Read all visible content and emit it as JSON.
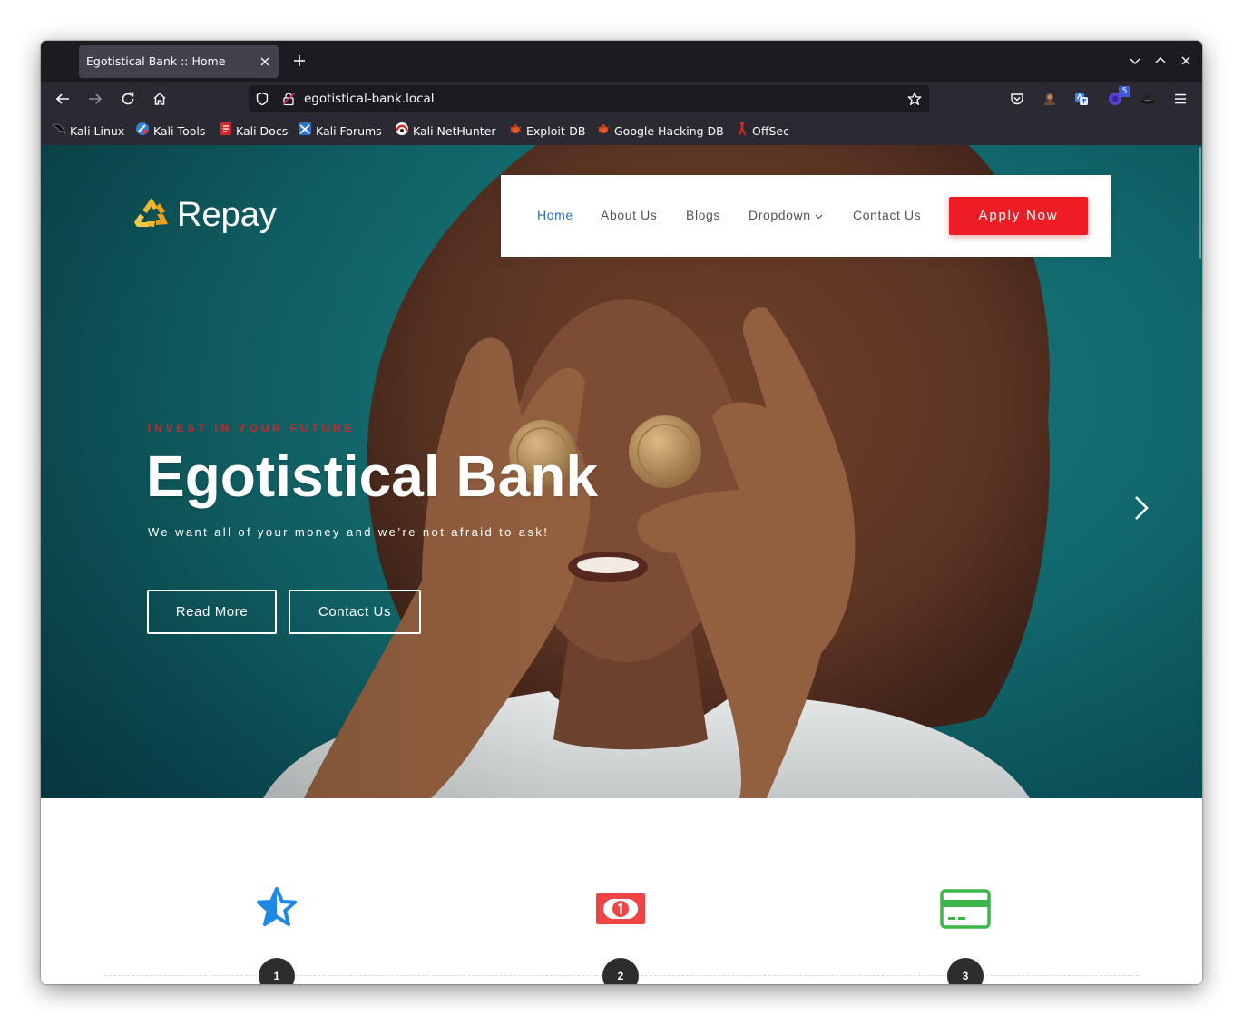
{
  "browser": {
    "tab_title": "Egotistical Bank :: Home",
    "url": "egotistical-bank.local",
    "extension_badge": "5",
    "bookmarks": [
      {
        "label": "Kali Linux",
        "icon": "kali-dragon-icon"
      },
      {
        "label": "Kali Tools",
        "icon": "kali-tools-icon"
      },
      {
        "label": "Kali Docs",
        "icon": "kali-docs-icon"
      },
      {
        "label": "Kali Forums",
        "icon": "kali-forums-icon"
      },
      {
        "label": "Kali NetHunter",
        "icon": "kali-nethunter-icon"
      },
      {
        "label": "Exploit-DB",
        "icon": "exploit-db-icon"
      },
      {
        "label": "Google Hacking DB",
        "icon": "exploit-db-icon"
      },
      {
        "label": "OffSec",
        "icon": "offsec-icon"
      }
    ]
  },
  "site": {
    "logo_text": "Repay",
    "logo_icon": "recycle-icon",
    "nav": [
      {
        "label": "Home",
        "active": true
      },
      {
        "label": "About Us",
        "active": false
      },
      {
        "label": "Blogs",
        "active": false
      },
      {
        "label": "Dropdown",
        "active": false,
        "has_submenu": true
      },
      {
        "label": "Contact Us",
        "active": false
      }
    ],
    "apply_button": "Apply Now",
    "colors": {
      "accent": "#ee1d25",
      "nav_active": "#2b6fc5",
      "nav_text": "#555555",
      "hero_teal": "#12696d"
    }
  },
  "hero": {
    "eyebrow": "INVEST IN YOUR FUTURE",
    "title": "Egotistical Bank",
    "tagline": "We want all of your money and we’re not afraid to ask!",
    "primary_button": "Read More",
    "secondary_button": "Contact Us",
    "next_slide_icon": "chevron-right-icon"
  },
  "features": [
    {
      "number": "1",
      "icon": "star-icon",
      "color": "#1e88e5"
    },
    {
      "number": "2",
      "icon": "money-bill-icon",
      "color": "#ef4444"
    },
    {
      "number": "3",
      "icon": "credit-card-icon",
      "color": "#3cb54a"
    }
  ]
}
